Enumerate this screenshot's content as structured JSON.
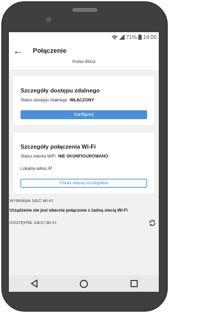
{
  "status_bar": {
    "battery_percent": "71%",
    "time": "14:00",
    "icons": [
      "wifi-icon",
      "signal-icon",
      "battery-icon"
    ]
  },
  "header": {
    "back_icon": "arrow-left-icon",
    "title": "Połączenie"
  },
  "device_name": "Roller Blind",
  "remote_access": {
    "title": "Szczegóły dostępu zdalnego",
    "status_label": "Status dostępu zdalnego",
    "status_value": "WŁĄCZONY",
    "configure_button": "Konfiguruj"
  },
  "wifi_details": {
    "title": "Szczegóły połączenia Wi-Fi",
    "client_status_label": "Status klienta WiFi",
    "client_status_value": "NIE SKONFIGUROWANO",
    "local_ip_label": "Lokalny adres IP",
    "more_details_button": "Pokaż więcej szczegółów"
  },
  "selected_network": {
    "label": "WYBRANA SIEĆ WI-FI",
    "text": "Urządzenie nie jest obecnie połączone z żadną siecią Wi-Fi"
  },
  "available_networks": {
    "label": "DOSTĘPNE SIECI WI-FI",
    "refresh_icon": "refresh-icon"
  },
  "nav": {
    "icons": [
      "back-triangle-icon",
      "home-circle-icon",
      "recents-square-icon"
    ]
  },
  "colors": {
    "accent": "#4c8fd6",
    "frame": "#3f3f3f",
    "background": "#f1f1f1"
  }
}
